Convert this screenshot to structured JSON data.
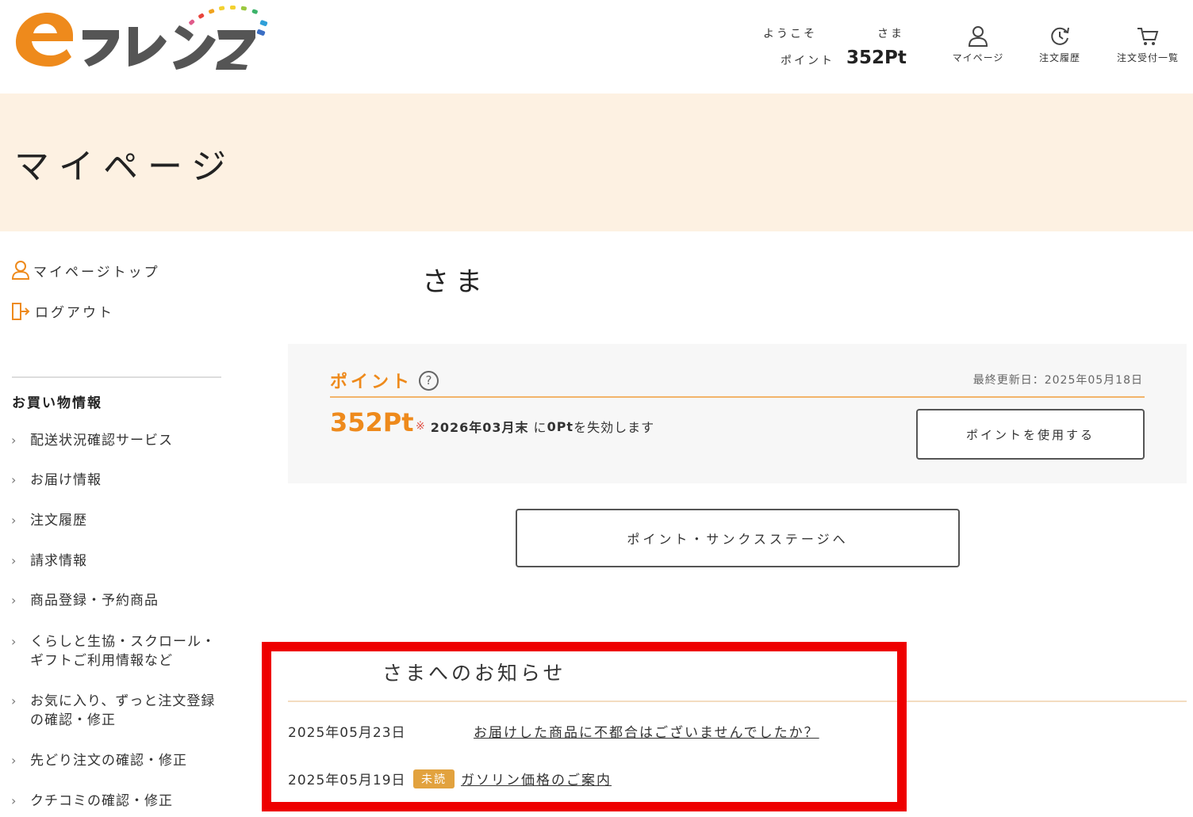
{
  "header": {
    "logo_text": "eフレンズ",
    "welcome": "ようこそ",
    "sama": "さま",
    "points_label": "ポイント",
    "points_value": "352Pt",
    "nav": [
      {
        "label": "マイページ",
        "icon": "user-icon"
      },
      {
        "label": "注文履歴",
        "icon": "history-icon"
      },
      {
        "label": "注文受付一覧",
        "icon": "cart-icon"
      }
    ]
  },
  "page_title": "マイページ",
  "sidebar": {
    "top_links": [
      {
        "label": "マイページトップ",
        "icon": "user-icon"
      },
      {
        "label": "ログアウト",
        "icon": "logout-icon"
      }
    ],
    "section_heading": "お買い物情報",
    "items": [
      {
        "lines": [
          "配送状況確認サービス"
        ]
      },
      {
        "lines": [
          "お届け情報"
        ]
      },
      {
        "lines": [
          "注文履歴"
        ]
      },
      {
        "lines": [
          "請求情報"
        ]
      },
      {
        "lines": [
          "商品登録・予約商品"
        ]
      },
      {
        "lines": [
          "くらしと生協・スクロール・",
          "ギフトご利用情報など"
        ]
      },
      {
        "lines": [
          "お気に入り、ずっと注文登録",
          "の確認・修正"
        ]
      },
      {
        "lines": [
          "先どり注文の確認・修正"
        ]
      },
      {
        "lines": [
          "クチコミの確認・修正"
        ]
      }
    ]
  },
  "main": {
    "sama": "さま",
    "points": {
      "title": "ポイント",
      "help": "?",
      "updated": "最終更新日：2025年05月18日",
      "value": "352Pt",
      "expire_mark": "※",
      "expire_date": "2026年03月末",
      "expire_ni": "に",
      "expire_amount": "0Pt",
      "expire_suffix": "を失効します",
      "use_button": "ポイントを使用する"
    },
    "stage_button": "ポイント・サンクスステージへ"
  },
  "notices": {
    "title": "さまへのお知らせ",
    "items": [
      {
        "date": "2025年05月23日",
        "badge": "",
        "text": "お届けした商品に不都合はございませんでしたか？"
      },
      {
        "date": "2025年05月19日",
        "badge": "未読",
        "text": "ガソリン価格のご案内"
      }
    ]
  },
  "colors": {
    "accent_orange": "#ee8a1c",
    "title_band": "#fdf1e2",
    "highlight_red": "#ee0000",
    "badge": "#e2a23e"
  }
}
